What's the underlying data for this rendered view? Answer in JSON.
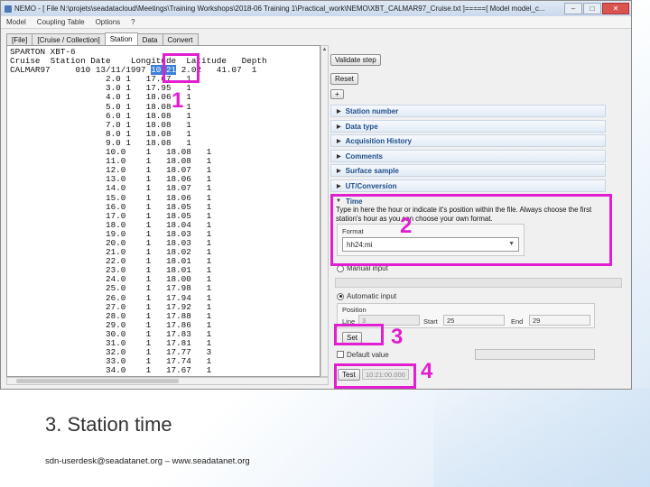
{
  "window": {
    "title": "NEMO - [ File N:\\projets\\seadatacloud\\Meetings\\Training Workshops\\2018-06 Training 1\\Practical_work\\NEMO\\XBT_CALMAR97_Cruise.txt ]=====[ Model model_c...",
    "min": "–",
    "max": "□",
    "close": "✕"
  },
  "menu": [
    "Model",
    "Coupling Table",
    "Options",
    "?"
  ],
  "tabs": [
    "[File]",
    "[Cruise / Collection]",
    "Station",
    "Data",
    "Convert"
  ],
  "file_lines": [
    "SPARTON XBT-6",
    "Cruise  Station Date    Longitude  Latitude   Depth",
    "CALMAR97     010 13/11/1997 ",
    "                   2.0 1   17.67   1",
    "                   3.0 1   17.95   1",
    "                   4.0 1   18.06   1",
    "                   5.0 1   18.08   1",
    "                   6.0 1   18.08   1",
    "                   7.0 1   18.08   1",
    "                   8.0 1   18.08   1",
    "                   9.0 1   18.08   1",
    "                   10.0    1   18.08   1",
    "                   11.0    1   18.08   1",
    "                   12.0    1   18.07   1",
    "                   13.0    1   18.06   1",
    "                   14.0    1   18.07   1",
    "                   15.0    1   18.06   1",
    "                   16.0    1   18.05   1",
    "                   17.0    1   18.05   1",
    "                   18.0    1   18.04   1",
    "                   19.0    1   18.03   1",
    "                   20.0    1   18.03   1",
    "                   21.0    1   18.02   1",
    "                   22.0    1   18.01   1",
    "                   23.0    1   18.01   1",
    "                   24.0    1   18.00   1",
    "                   25.0    1   17.98   1",
    "                   26.0    1   17.94   1",
    "                   27.0    1   17.92   1",
    "                   28.0    1   17.88   1",
    "                   29.0    1   17.86   1",
    "                   30.0    1   17.83   1",
    "                   31.0    1   17.81   1",
    "                   32.0    1   17.77   3",
    "                   33.0    1   17.74   1",
    "                   34.0    1   17.67   1"
  ],
  "selected_time": "10:21",
  "calmar_tail": " 2.02   41.07  1",
  "panel": {
    "validate_button": "Validate step",
    "reset_button": "Reset",
    "plus_button": "+",
    "sections": [
      "Station number",
      "Data type",
      "Acquisition History",
      "Comments",
      "Surface sample",
      "UT/Conversion"
    ],
    "time_section": "Time",
    "time_description": "Type in here the hour or indicate it's position within the file. Always choose the first station's hour as you can choose your own format.",
    "format_label": "Format",
    "format_value": "hh24:mi",
    "manual_input": "Manual input",
    "automatic_input": "Automatic input",
    "position_label": "Position",
    "line_label": "Line",
    "line_value": "3",
    "start_label": "Start",
    "start_value": "25",
    "end_label": "End",
    "end_value": "29",
    "set_button": "Set",
    "default_value_label": "Default value",
    "test_button": "Test",
    "test_value": "10:21:00.000"
  },
  "annotations": [
    "1",
    "2",
    "3",
    "4"
  ],
  "slide": {
    "title": "3. Station time",
    "footer": "sdn-userdesk@seadatanet.org – www.seadatanet.org"
  },
  "colors": {
    "highlight": "#e21fd0",
    "section_text": "#1f4e8a",
    "selection": "#3b7fd9"
  }
}
